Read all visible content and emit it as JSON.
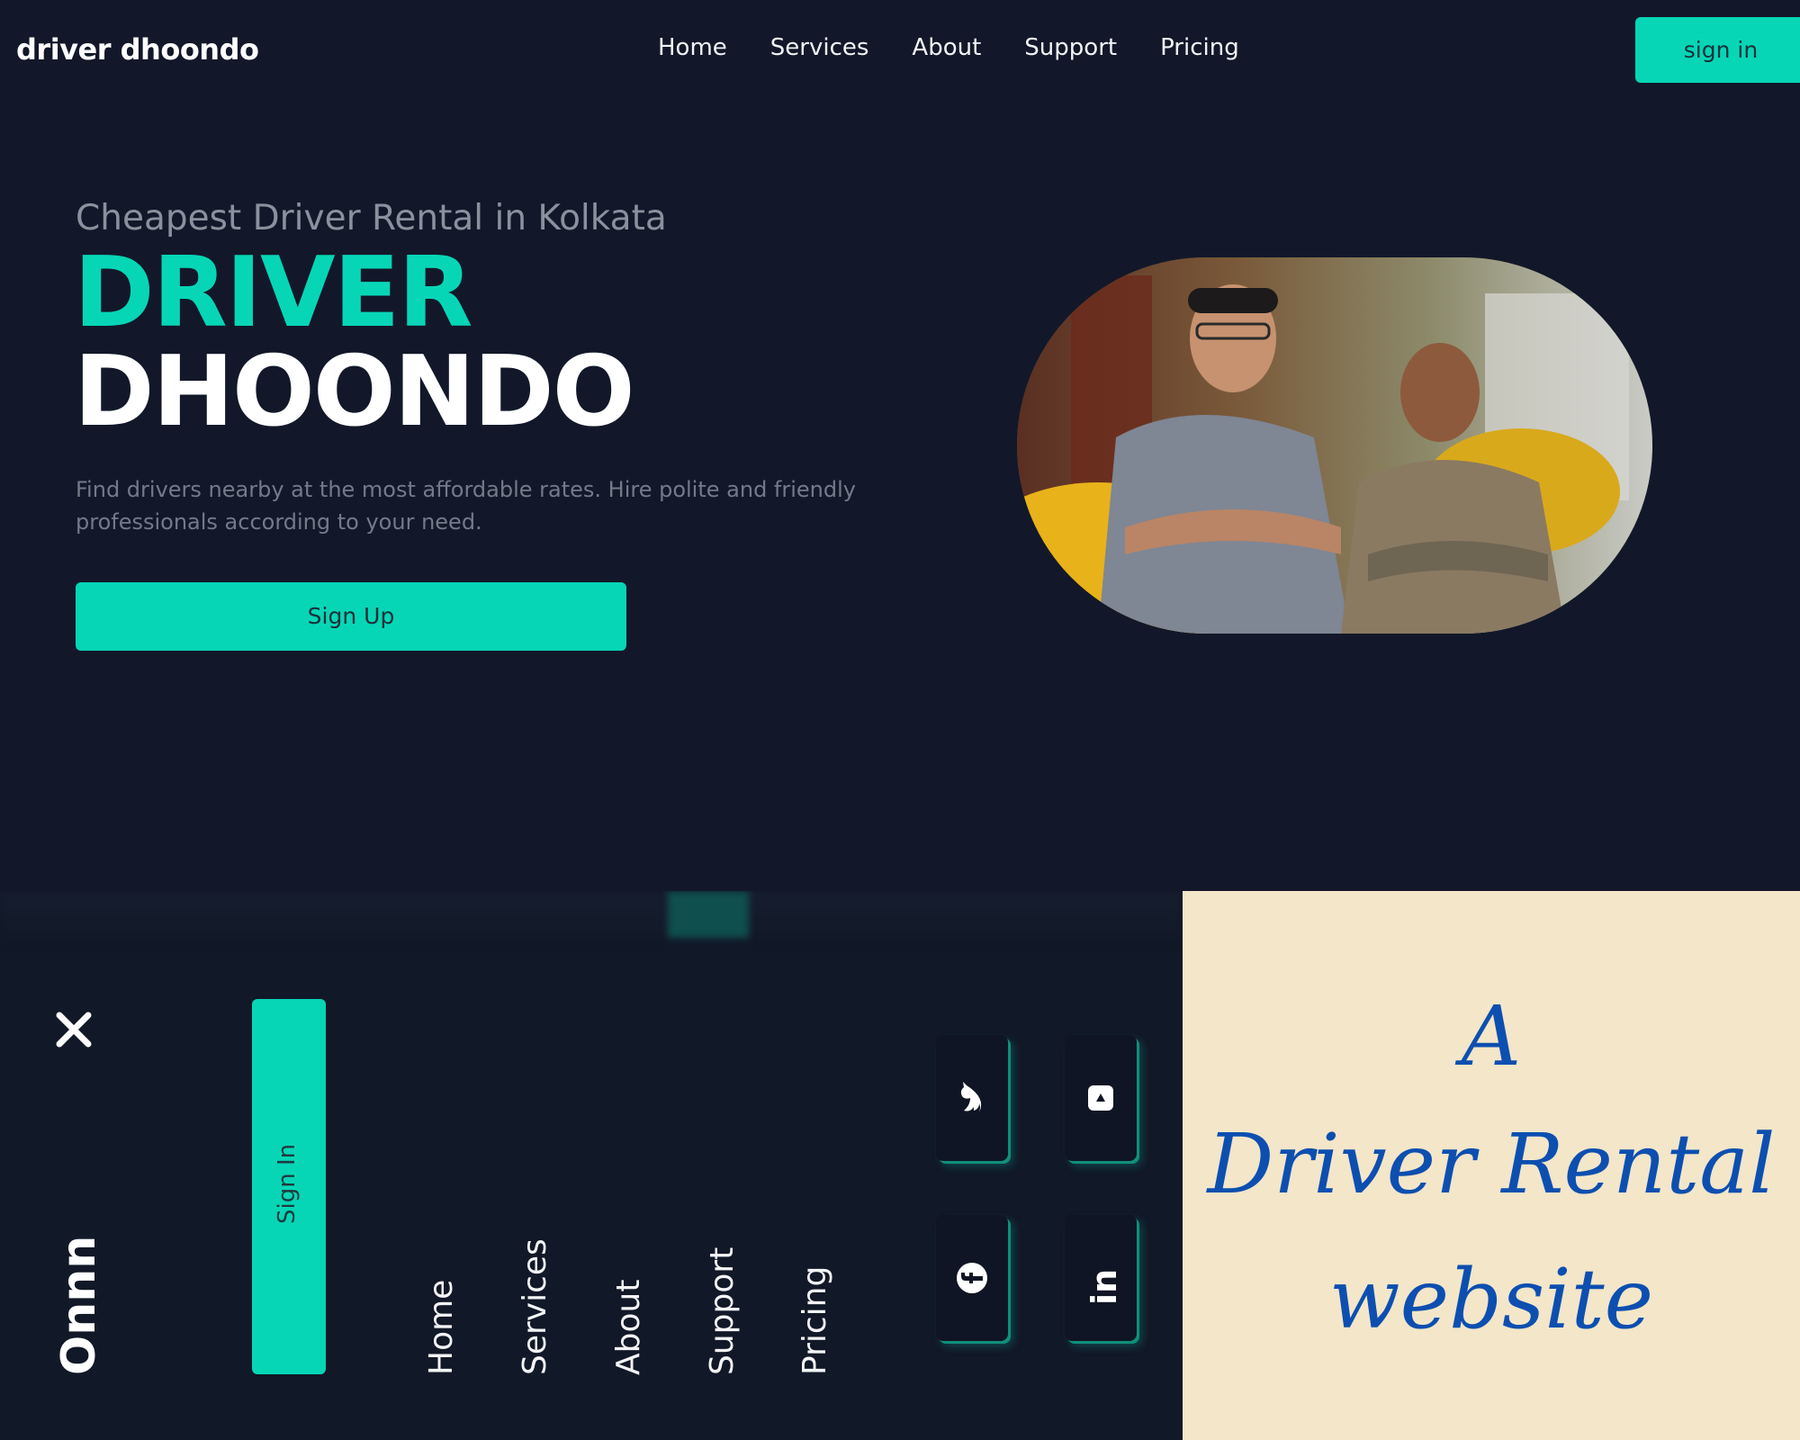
{
  "nav": {
    "logo": "driver dhoondo",
    "links": [
      "Home",
      "Services",
      "About",
      "Support",
      "Pricing"
    ],
    "signin_label": "sign in"
  },
  "hero": {
    "subtitle": "Cheapest Driver Rental in Kolkata",
    "title_line1": "DRIVER",
    "title_line2": "DHOONDO",
    "description": "Find drivers nearby at the most affordable rates. Hire polite and friendly professionals according to your need.",
    "signup_label": "Sign Up"
  },
  "mobile_menu": {
    "brand": "Onnn",
    "signin_label": "Sign In",
    "links": [
      "Home",
      "Services",
      "About",
      "Support",
      "Pricing"
    ],
    "social_icons": [
      "twitter-icon",
      "instagram-icon",
      "facebook-icon",
      "linkedin-icon"
    ],
    "linkedin_text": "in"
  },
  "caption": {
    "line1": "A",
    "line2": "Driver Rental",
    "line3": "website"
  },
  "colors": {
    "background": "#121829",
    "accent": "#06d6b6",
    "caption_bg": "#f3e6c9",
    "caption_text": "#0d4fb0"
  }
}
